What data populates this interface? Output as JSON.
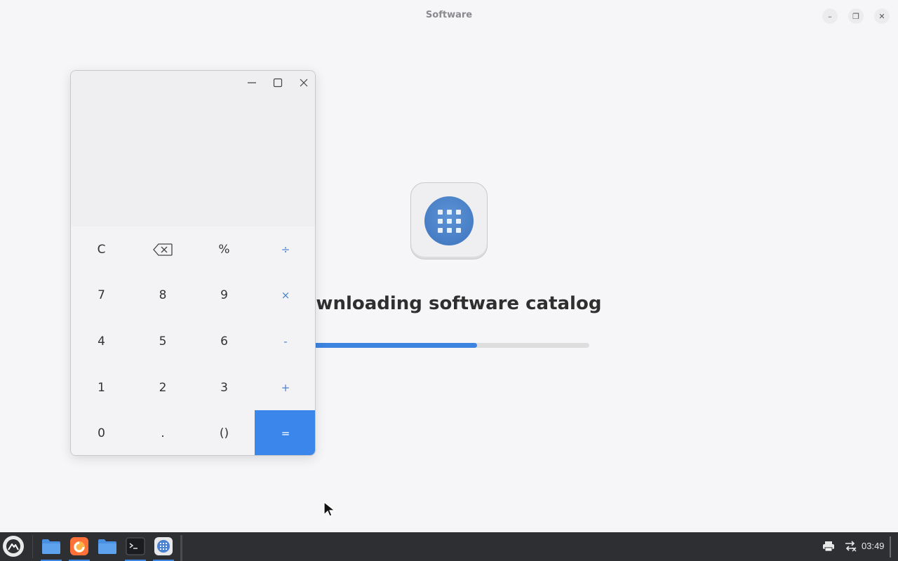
{
  "software_window": {
    "title": "Software",
    "controls": {
      "minimize": "–",
      "maximize": "❐",
      "close": "✕"
    },
    "status_heading": "ownloading software catalog",
    "progress_fraction": 0.6,
    "app_icon": "app-grid-icon"
  },
  "calculator": {
    "display_value": "",
    "keys": [
      {
        "label": "C",
        "kind": "fn"
      },
      {
        "label": "",
        "kind": "fn",
        "icon": "backspace-icon"
      },
      {
        "label": "%",
        "kind": "fn"
      },
      {
        "label": "÷",
        "kind": "op"
      },
      {
        "label": "7",
        "kind": "num"
      },
      {
        "label": "8",
        "kind": "num"
      },
      {
        "label": "9",
        "kind": "num"
      },
      {
        "label": "×",
        "kind": "op"
      },
      {
        "label": "4",
        "kind": "num"
      },
      {
        "label": "5",
        "kind": "num"
      },
      {
        "label": "6",
        "kind": "num"
      },
      {
        "label": "-",
        "kind": "op"
      },
      {
        "label": "1",
        "kind": "num"
      },
      {
        "label": "2",
        "kind": "num"
      },
      {
        "label": "3",
        "kind": "num"
      },
      {
        "label": "+",
        "kind": "op"
      },
      {
        "label": "0",
        "kind": "num"
      },
      {
        "label": ".",
        "kind": "num"
      },
      {
        "label": "()",
        "kind": "num"
      },
      {
        "label": "=",
        "kind": "eq"
      }
    ]
  },
  "taskbar": {
    "apps": [
      "files-icon",
      "firefox-icon",
      "files-icon",
      "terminal-icon",
      "software-icon"
    ],
    "clock": "03:49",
    "tray": [
      "printer-icon",
      "network-icon"
    ]
  },
  "colors": {
    "accent": "#3b86ea",
    "operator": "#4a82cf",
    "taskbar": "#2d2f33"
  }
}
